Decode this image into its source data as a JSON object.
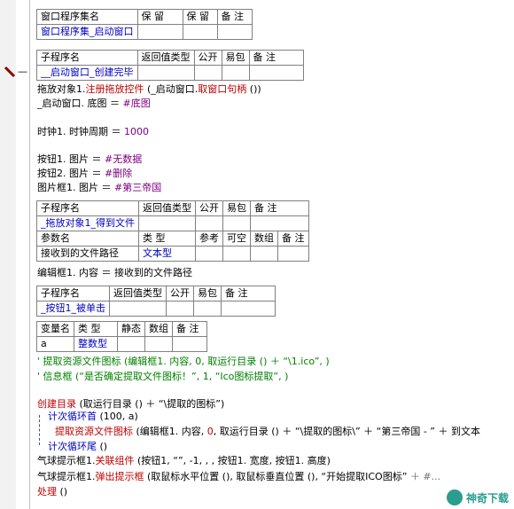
{
  "table1": {
    "headers": [
      "窗口程序集名",
      "保 留",
      "保 留",
      "备 注"
    ],
    "row": [
      "窗口程序集_启动窗口",
      "",
      "",
      ""
    ]
  },
  "table2": {
    "headers": [
      "子程序名",
      "返回值类型",
      "公开",
      "易包",
      "备 注"
    ],
    "row": [
      "__启动窗口_创建完毕",
      "",
      "",
      "",
      ""
    ]
  },
  "code1": [
    {
      "parts": [
        "拖放对象1.",
        "注册拖放控件",
        " (_启动窗口.",
        "取窗口句柄",
        " ())"
      ]
    },
    {
      "parts": [
        "_启动窗口. 底图 ＝ ",
        "#底图"
      ]
    },
    {
      "parts": [
        "时钟1. 时钟周期 ＝ ",
        "1000"
      ]
    },
    {
      "parts": [
        "按钮1. 图片 ＝ ",
        "#无数据"
      ]
    },
    {
      "parts": [
        "按钮2. 图片 ＝ ",
        "#删除"
      ]
    },
    {
      "parts": [
        "图片框1. 图片 ＝ ",
        "#第三帝国"
      ]
    }
  ],
  "table3": {
    "headers": [
      "子程序名",
      "返回值类型",
      "公开",
      "易包",
      "备 注"
    ],
    "row": [
      "_拖放对象1_得到文件",
      "",
      "",
      "",
      ""
    ],
    "param_headers": [
      "参数名",
      "类 型",
      "参考",
      "可空",
      "数组",
      "备 注"
    ],
    "param_row": [
      "接收到的文件路径",
      "文本型",
      "",
      "",
      "",
      ""
    ]
  },
  "code2": "编辑框1. 内容 ＝ 接收到的文件路径",
  "table4": {
    "headers": [
      "子程序名",
      "返回值类型",
      "公开",
      "易包",
      "备 注"
    ],
    "row": [
      "_按钮1_被单击",
      "",
      "",
      "",
      ""
    ]
  },
  "table5": {
    "headers": [
      "变量名",
      "类 型",
      "静态",
      "数组",
      "备 注"
    ],
    "row": [
      "a",
      "整数型",
      "",
      "",
      ""
    ]
  },
  "comments": [
    "' 提取资源文件图标 (编辑框1. 内容, 0, 取运行目录 () ＋ “\\1.ico”, )",
    "' 信息框 (“是否确定提取文件图标！”, 1, “Ico图标提取”, )"
  ],
  "code3": [
    {
      "parts": [
        "创建目录",
        " (取运行目录 () ＋ “\\提取的图标”)"
      ]
    },
    {
      "parts": [
        "计次循环首",
        " (100, a)"
      ]
    },
    {
      "parts": [
        "提取资源文件图标",
        " (编辑框1. 内容, ",
        "0",
        ", 取运行目录 () ＋ “\\提取的图标\\” ＋ “第三帝国 - ” ＋ 到文本"
      ]
    },
    {
      "parts": [
        "计次循环尾",
        " ()"
      ]
    },
    {
      "parts": [
        "气球提示框1.",
        "关联组件",
        " (按钮1, “”, -1, , , 按钮1. 宽度, 按钮1. 高度)"
      ]
    },
    {
      "parts": [
        "气球提示框1.",
        "弹出提示框",
        " (取鼠标水平位置 (), 取鼠标垂直位置 (), “开始提取ICO图标”",
        " ＋ ",
        "#..."
      ]
    },
    {
      "parts": [
        "处理",
        " ()"
      ]
    }
  ],
  "watermark": "神奇下载"
}
